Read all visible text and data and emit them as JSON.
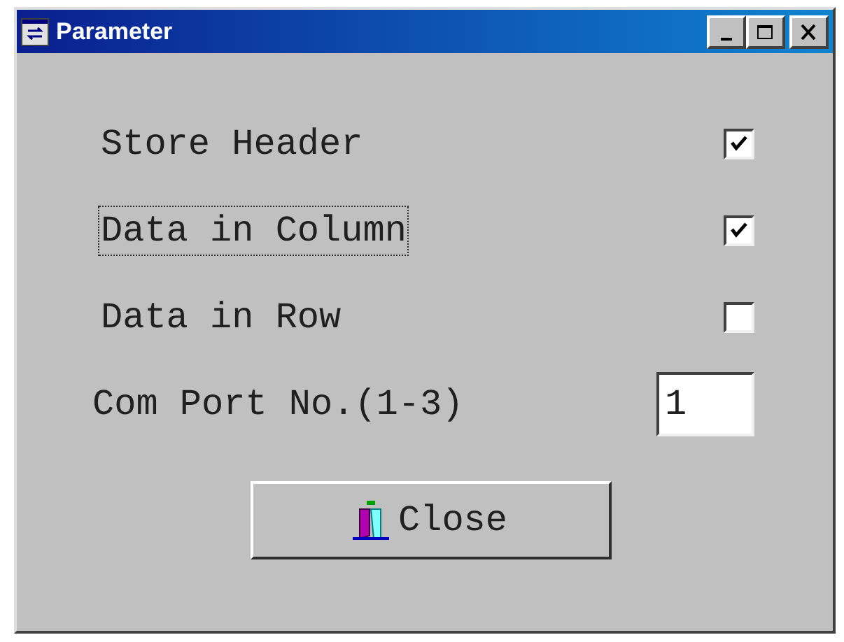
{
  "window": {
    "title": "Parameter"
  },
  "options": [
    {
      "label": "Store Header",
      "checked": true,
      "focused": false
    },
    {
      "label": "Data in Column",
      "checked": true,
      "focused": true
    },
    {
      "label": "Data in Row",
      "checked": false,
      "focused": false
    }
  ],
  "com_port": {
    "label": "Com Port No.(1-3)",
    "value": "1"
  },
  "buttons": [
    {
      "label": "Close"
    }
  ]
}
